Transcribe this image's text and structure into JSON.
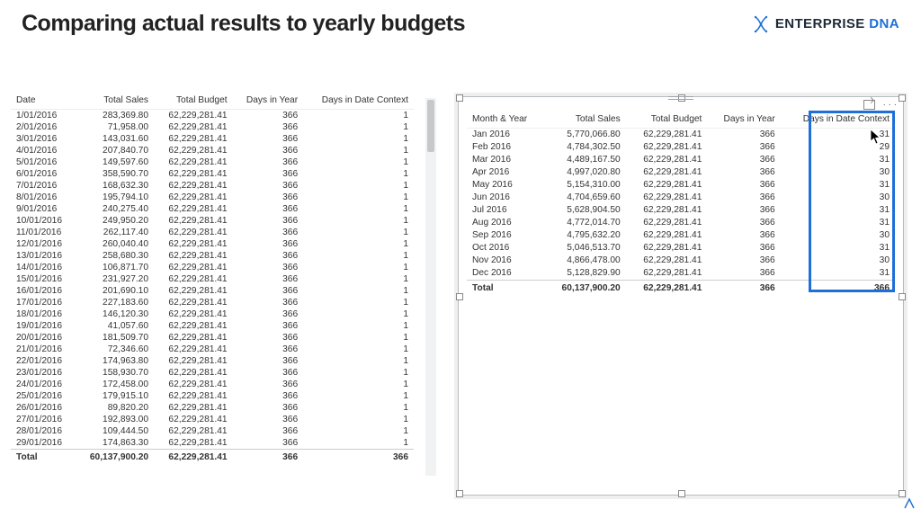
{
  "header": {
    "title": "Comparing actual results to yearly budgets",
    "brand1": "ENTERPRISE",
    "brand2": "DNA"
  },
  "left": {
    "cols": [
      "Date",
      "Total Sales",
      "Total Budget",
      "Days in Year",
      "Days in Date Context"
    ],
    "rows": [
      {
        "date": "1/01/2016",
        "sales": "283,369.80",
        "budget": "62,229,281.41",
        "diy": "366",
        "ddc": "1"
      },
      {
        "date": "2/01/2016",
        "sales": "71,958.00",
        "budget": "62,229,281.41",
        "diy": "366",
        "ddc": "1"
      },
      {
        "date": "3/01/2016",
        "sales": "143,031.60",
        "budget": "62,229,281.41",
        "diy": "366",
        "ddc": "1"
      },
      {
        "date": "4/01/2016",
        "sales": "207,840.70",
        "budget": "62,229,281.41",
        "diy": "366",
        "ddc": "1"
      },
      {
        "date": "5/01/2016",
        "sales": "149,597.60",
        "budget": "62,229,281.41",
        "diy": "366",
        "ddc": "1"
      },
      {
        "date": "6/01/2016",
        "sales": "358,590.70",
        "budget": "62,229,281.41",
        "diy": "366",
        "ddc": "1"
      },
      {
        "date": "7/01/2016",
        "sales": "168,632.30",
        "budget": "62,229,281.41",
        "diy": "366",
        "ddc": "1"
      },
      {
        "date": "8/01/2016",
        "sales": "195,794.10",
        "budget": "62,229,281.41",
        "diy": "366",
        "ddc": "1"
      },
      {
        "date": "9/01/2016",
        "sales": "240,275.40",
        "budget": "62,229,281.41",
        "diy": "366",
        "ddc": "1"
      },
      {
        "date": "10/01/2016",
        "sales": "249,950.20",
        "budget": "62,229,281.41",
        "diy": "366",
        "ddc": "1"
      },
      {
        "date": "11/01/2016",
        "sales": "262,117.40",
        "budget": "62,229,281.41",
        "diy": "366",
        "ddc": "1"
      },
      {
        "date": "12/01/2016",
        "sales": "260,040.40",
        "budget": "62,229,281.41",
        "diy": "366",
        "ddc": "1"
      },
      {
        "date": "13/01/2016",
        "sales": "258,680.30",
        "budget": "62,229,281.41",
        "diy": "366",
        "ddc": "1"
      },
      {
        "date": "14/01/2016",
        "sales": "106,871.70",
        "budget": "62,229,281.41",
        "diy": "366",
        "ddc": "1"
      },
      {
        "date": "15/01/2016",
        "sales": "231,927.20",
        "budget": "62,229,281.41",
        "diy": "366",
        "ddc": "1"
      },
      {
        "date": "16/01/2016",
        "sales": "201,690.10",
        "budget": "62,229,281.41",
        "diy": "366",
        "ddc": "1"
      },
      {
        "date": "17/01/2016",
        "sales": "227,183.60",
        "budget": "62,229,281.41",
        "diy": "366",
        "ddc": "1"
      },
      {
        "date": "18/01/2016",
        "sales": "146,120.30",
        "budget": "62,229,281.41",
        "diy": "366",
        "ddc": "1"
      },
      {
        "date": "19/01/2016",
        "sales": "41,057.60",
        "budget": "62,229,281.41",
        "diy": "366",
        "ddc": "1"
      },
      {
        "date": "20/01/2016",
        "sales": "181,509.70",
        "budget": "62,229,281.41",
        "diy": "366",
        "ddc": "1"
      },
      {
        "date": "21/01/2016",
        "sales": "72,346.60",
        "budget": "62,229,281.41",
        "diy": "366",
        "ddc": "1"
      },
      {
        "date": "22/01/2016",
        "sales": "174,963.80",
        "budget": "62,229,281.41",
        "diy": "366",
        "ddc": "1"
      },
      {
        "date": "23/01/2016",
        "sales": "158,930.70",
        "budget": "62,229,281.41",
        "diy": "366",
        "ddc": "1"
      },
      {
        "date": "24/01/2016",
        "sales": "172,458.00",
        "budget": "62,229,281.41",
        "diy": "366",
        "ddc": "1"
      },
      {
        "date": "25/01/2016",
        "sales": "179,915.10",
        "budget": "62,229,281.41",
        "diy": "366",
        "ddc": "1"
      },
      {
        "date": "26/01/2016",
        "sales": "89,820.20",
        "budget": "62,229,281.41",
        "diy": "366",
        "ddc": "1"
      },
      {
        "date": "27/01/2016",
        "sales": "192,893.00",
        "budget": "62,229,281.41",
        "diy": "366",
        "ddc": "1"
      },
      {
        "date": "28/01/2016",
        "sales": "109,444.50",
        "budget": "62,229,281.41",
        "diy": "366",
        "ddc": "1"
      },
      {
        "date": "29/01/2016",
        "sales": "174,863.30",
        "budget": "62,229,281.41",
        "diy": "366",
        "ddc": "1"
      }
    ],
    "total": {
      "label": "Total",
      "sales": "60,137,900.20",
      "budget": "62,229,281.41",
      "diy": "366",
      "ddc": "366"
    }
  },
  "right": {
    "cols": [
      "Month & Year",
      "Total Sales",
      "Total Budget",
      "Days in Year",
      "Days in Date Context"
    ],
    "rows": [
      {
        "my": "Jan 2016",
        "sales": "5,770,066.80",
        "budget": "62,229,281.41",
        "diy": "366",
        "ddc": "31"
      },
      {
        "my": "Feb 2016",
        "sales": "4,784,302.50",
        "budget": "62,229,281.41",
        "diy": "366",
        "ddc": "29"
      },
      {
        "my": "Mar 2016",
        "sales": "4,489,167.50",
        "budget": "62,229,281.41",
        "diy": "366",
        "ddc": "31"
      },
      {
        "my": "Apr 2016",
        "sales": "4,997,020.80",
        "budget": "62,229,281.41",
        "diy": "366",
        "ddc": "30"
      },
      {
        "my": "May 2016",
        "sales": "5,154,310.00",
        "budget": "62,229,281.41",
        "diy": "366",
        "ddc": "31"
      },
      {
        "my": "Jun 2016",
        "sales": "4,704,659.60",
        "budget": "62,229,281.41",
        "diy": "366",
        "ddc": "30"
      },
      {
        "my": "Jul 2016",
        "sales": "5,628,904.50",
        "budget": "62,229,281.41",
        "diy": "366",
        "ddc": "31"
      },
      {
        "my": "Aug 2016",
        "sales": "4,772,014.70",
        "budget": "62,229,281.41",
        "diy": "366",
        "ddc": "31"
      },
      {
        "my": "Sep 2016",
        "sales": "4,795,632.20",
        "budget": "62,229,281.41",
        "diy": "366",
        "ddc": "30"
      },
      {
        "my": "Oct 2016",
        "sales": "5,046,513.70",
        "budget": "62,229,281.41",
        "diy": "366",
        "ddc": "31"
      },
      {
        "my": "Nov 2016",
        "sales": "4,866,478.00",
        "budget": "62,229,281.41",
        "diy": "366",
        "ddc": "30"
      },
      {
        "my": "Dec 2016",
        "sales": "5,128,829.90",
        "budget": "62,229,281.41",
        "diy": "366",
        "ddc": "31"
      }
    ],
    "total": {
      "label": "Total",
      "sales": "60,137,900.20",
      "budget": "62,229,281.41",
      "diy": "366",
      "ddc": "366"
    }
  },
  "icons": {
    "dna": "dna-icon",
    "focus": "focus-mode-icon",
    "more": "more-options-icon",
    "sub": "subscribe-icon"
  }
}
